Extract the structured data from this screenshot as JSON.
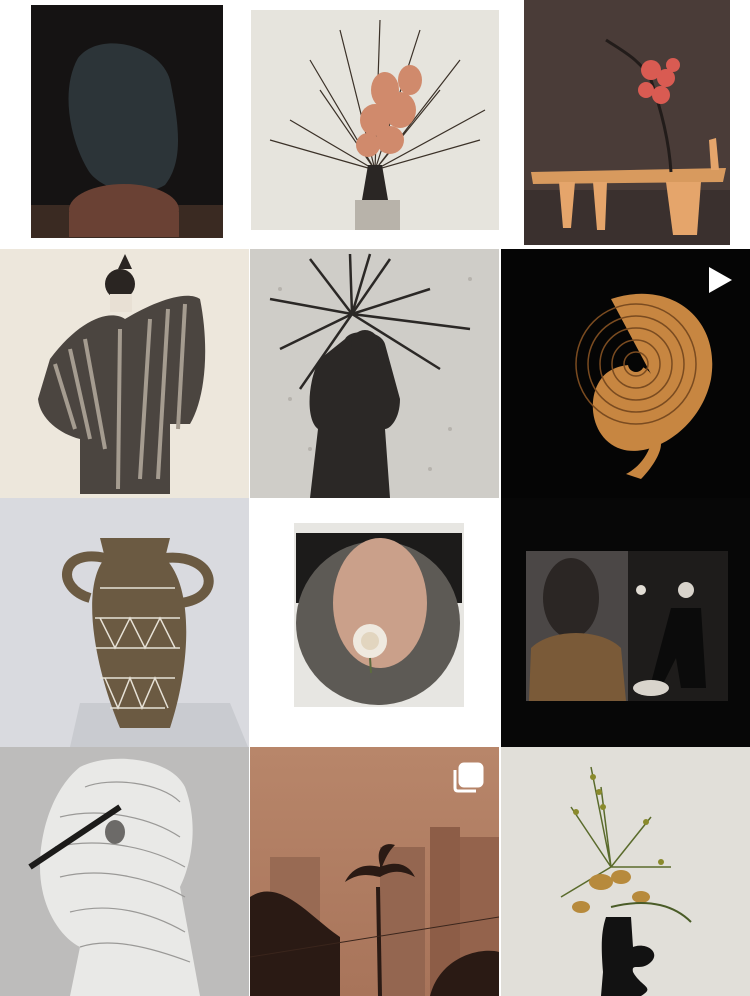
{
  "grid": {
    "posts": [
      {
        "id": "post-1",
        "subject": "dark-abstract-cutout",
        "type": "image"
      },
      {
        "id": "post-2",
        "subject": "anthurium-branch-arrangement",
        "type": "image"
      },
      {
        "id": "post-3",
        "subject": "quince-on-wooden-bench",
        "type": "image"
      },
      {
        "id": "post-4",
        "subject": "striped-coat-figure",
        "type": "image"
      },
      {
        "id": "post-5",
        "subject": "shadow-on-sand",
        "type": "image"
      },
      {
        "id": "post-6",
        "subject": "orange-spiral-sculpture",
        "type": "video",
        "badge": "play-icon"
      },
      {
        "id": "post-7",
        "subject": "incised-ceramic-vase",
        "type": "image"
      },
      {
        "id": "post-8",
        "subject": "oval-collage-with-flower",
        "type": "image"
      },
      {
        "id": "post-9",
        "subject": "diptych-performance",
        "type": "image"
      },
      {
        "id": "post-10",
        "subject": "pleated-sculptural-garment",
        "type": "image"
      },
      {
        "id": "post-11",
        "subject": "palm-trees-city-haze",
        "type": "carousel",
        "badge": "multiple-images-icon"
      },
      {
        "id": "post-12",
        "subject": "ikebana-in-black-vase",
        "type": "image"
      }
    ]
  },
  "colors": {
    "background": "#ffffff",
    "overlay_icon": "#ffffff"
  }
}
